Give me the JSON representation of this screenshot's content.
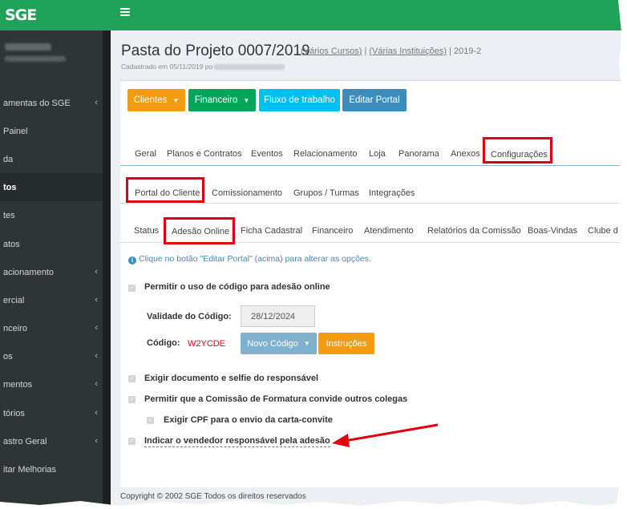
{
  "app": {
    "logo": "SGE"
  },
  "sidebar": {
    "items": [
      {
        "label": "amentas do SGE",
        "chevron": "‹"
      },
      {
        "label": "Painel",
        "chevron": ""
      },
      {
        "label": "da",
        "chevron": ""
      },
      {
        "label": "tos",
        "chevron": "",
        "active": true
      },
      {
        "label": "tes",
        "chevron": ""
      },
      {
        "label": "atos",
        "chevron": ""
      },
      {
        "label": "acionamento",
        "chevron": "‹"
      },
      {
        "label": "ercial",
        "chevron": "‹"
      },
      {
        "label": "nceiro",
        "chevron": "‹"
      },
      {
        "label": "os",
        "chevron": "‹"
      },
      {
        "label": "mentos",
        "chevron": "‹"
      },
      {
        "label": "tórios",
        "chevron": "‹"
      },
      {
        "label": "astro Geral",
        "chevron": "‹"
      },
      {
        "label": "itar Melhorias",
        "chevron": ""
      }
    ]
  },
  "header": {
    "title": "Pasta do Projeto 0007/2019",
    "link_cursos": "(Vários Cursos)",
    "sep1": "|",
    "link_instituicoes": "(Várias Instituições)",
    "sep2": "|",
    "suffix": "2019-2",
    "cadastro": "Cadastrado em 05/11/2019 po"
  },
  "toolbar": {
    "clientes": "Clientes",
    "financeiro": "Financeiro",
    "fluxo": "Fluxo de trabalho",
    "editar": "Editar Portal"
  },
  "tabs_main": [
    "Geral",
    "Planos e Contratos",
    "Eventos",
    "Relacionamento",
    "Loja",
    "Panorama",
    "Anexos",
    "Configurações"
  ],
  "tabs_config": [
    "Portal do Cliente",
    "Comissionamento",
    "Grupos / Turmas",
    "Integrações"
  ],
  "tabs_portal": [
    "Status",
    "Adesão Online",
    "Ficha Cadastral",
    "Financeiro",
    "Atendimento",
    "Relatórios da Comissão",
    "Boas-Vindas",
    "Clube d"
  ],
  "info": "Clique no botão \"Editar Portal\" (acima) para alterar as opções.",
  "options": {
    "codigo_adesao": "Permitir o uso de código para adesão online",
    "validade_label": "Validade do Código:",
    "validade_value": "28/12/2024",
    "codigo_label": "Código:",
    "codigo_value": "W2YCDE",
    "novo_codigo": "Novo Código",
    "instrucoes": "Instruções",
    "exigir_doc": "Exigir documento e selfie do responsável",
    "comissao_convide": "Permitir que a Comissão de Formatura convide outros colegas",
    "exigir_cpf": "Exigir CPF para o envio da carta-convite",
    "indicar_vendedor": "Indicar o vendedor responsável pela adesão"
  },
  "footer": "Copyright © 2002 SGE Todos os direitos reservados",
  "colors": {
    "green": "#1fa35a",
    "orange": "#f39c12",
    "teal_green": "#00a65a",
    "cyan": "#00c0ef",
    "blue": "#3c8dbc",
    "light_blue": "#7fb1cf",
    "red_highlight": "#e2000f"
  }
}
